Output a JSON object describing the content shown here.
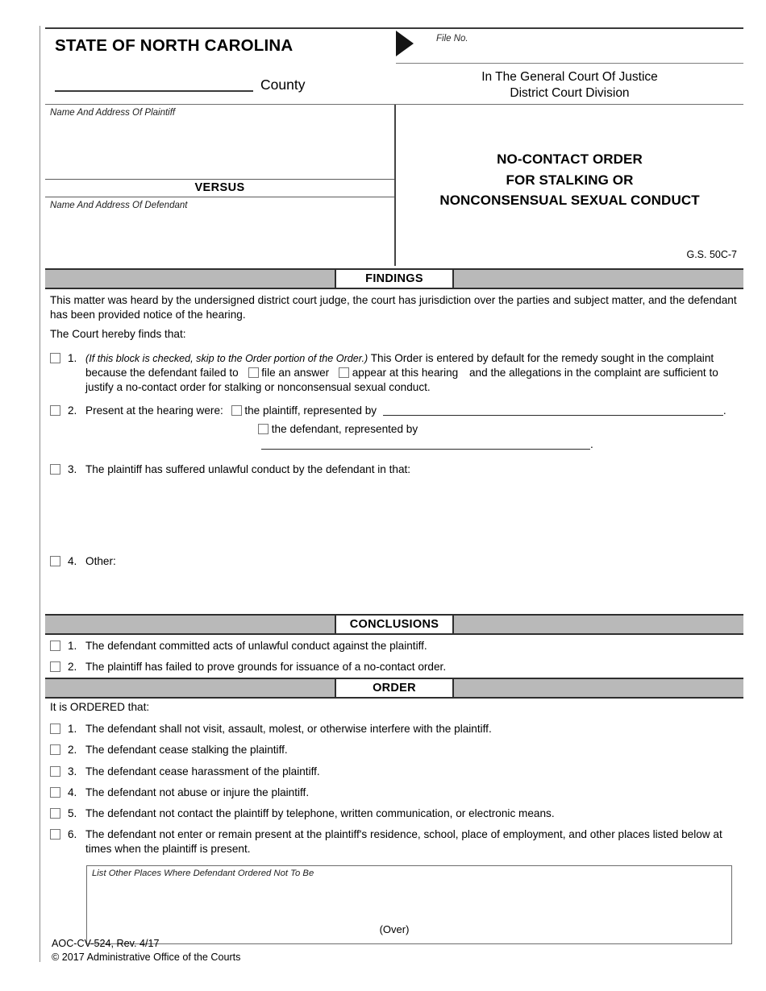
{
  "header": {
    "state_title": "STATE OF NORTH CAROLINA",
    "county_label": "County",
    "file_no_label": "File No.",
    "court_line1": "In The General Court Of Justice",
    "court_line2": "District Court Division"
  },
  "caption": {
    "plaintiff_label": "Name And Address Of Plaintiff",
    "versus": "VERSUS",
    "defendant_label": "Name And Address Of Defendant",
    "doc_title_line1": "NO-CONTACT ORDER",
    "doc_title_line2": "FOR STALKING OR",
    "doc_title_line3": "NONCONSENSUAL SEXUAL CONDUCT",
    "statute": "G.S. 50C-7"
  },
  "findings": {
    "band_title": "FINDINGS",
    "intro_paragraph": "This matter was heard by the undersigned district court judge, the court has jurisdiction over the parties and subject matter, and the defendant has been provided notice of the hearing.",
    "intro_paragraph2": "The Court hereby finds that:",
    "item1": {
      "number": "1.",
      "italic_note": "(If this block is checked, skip to the Order portion of the Order.)",
      "text_a": "This Order is entered by default for the remedy sought in the complaint because the defendant failed to",
      "option_a": "file an answer",
      "option_b": "appear at this hearing",
      "text_b": "and the allegations in the complaint are sufficient to justify a no-contact order for stalking or nonconsensual sexual conduct."
    },
    "item2": {
      "number": "2.",
      "text": "Present at the hearing were:",
      "sub_a": "the plaintiff, represented by",
      "sub_b": "the defendant, represented by"
    },
    "item3": {
      "number": "3.",
      "text": "The plaintiff has suffered unlawful conduct by the defendant in that:"
    },
    "item4": {
      "number": "4.",
      "text": "Other:"
    }
  },
  "conclusions": {
    "band_title": "CONCLUSIONS",
    "items": [
      {
        "number": "1.",
        "text": "The defendant committed acts of unlawful conduct against the plaintiff."
      },
      {
        "number": "2.",
        "text": "The plaintiff has failed to prove grounds for issuance of a no-contact order."
      }
    ]
  },
  "order": {
    "band_title": "ORDER",
    "intro": "It is ORDERED that:",
    "items": [
      {
        "number": "1.",
        "text": "The defendant shall not visit, assault, molest, or otherwise interfere with the plaintiff."
      },
      {
        "number": "2.",
        "text": "The defendant cease stalking the plaintiff."
      },
      {
        "number": "3.",
        "text": "The defendant cease harassment of the plaintiff."
      },
      {
        "number": "4.",
        "text": "The defendant not abuse or injure the plaintiff."
      },
      {
        "number": "5.",
        "text": "The defendant not contact the plaintiff by telephone, written communication, or electronic means."
      },
      {
        "number": "6.",
        "text": "The defendant not enter or remain present at the plaintiff's residence, school, place of employment, and other places listed below at times when the plaintiff is present."
      }
    ],
    "listbox_label": "List Other Places Where Defendant Ordered Not To Be"
  },
  "footer": {
    "over": "(Over)",
    "form_id": "AOC-CV-524, Rev. 4/17",
    "copyright": "© 2017 Administrative Office of the Courts"
  }
}
